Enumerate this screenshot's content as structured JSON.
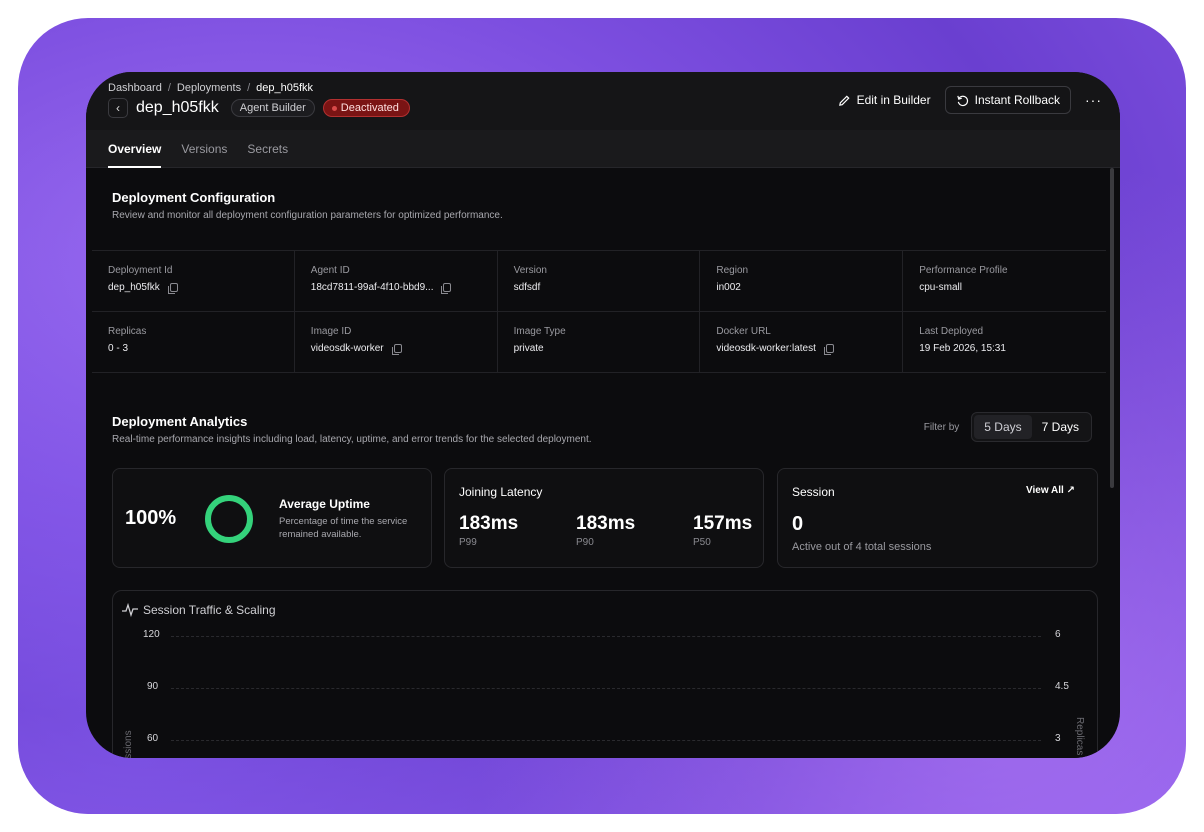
{
  "breadcrumb": [
    "Dashboard",
    "Deployments",
    "dep_h05fkk"
  ],
  "header": {
    "title": "dep_h05fkk",
    "tag_builder": "Agent Builder",
    "tag_status": "Deactivated",
    "edit_label": "Edit in Builder",
    "rollback_label": "Instant Rollback",
    "more_label": "···"
  },
  "tabs": [
    "Overview",
    "Versions",
    "Secrets"
  ],
  "config": {
    "title": "Deployment Configuration",
    "desc": "Review and monitor all deployment configuration parameters for optimized performance.",
    "row1": [
      {
        "label": "Deployment Id",
        "value": "dep_h05fkk",
        "copy": true
      },
      {
        "label": "Agent ID",
        "value": "18cd7811-99af-4f10-bbd9...",
        "copy": true
      },
      {
        "label": "Version",
        "value": "sdfsdf"
      },
      {
        "label": "Region",
        "value": "in002"
      },
      {
        "label": "Performance Profile",
        "value": "cpu-small"
      }
    ],
    "row2": [
      {
        "label": "Replicas",
        "value": "0 - 3"
      },
      {
        "label": "Image ID",
        "value": "videosdk-worker",
        "copy": true
      },
      {
        "label": "Image Type",
        "value": "private"
      },
      {
        "label": "Docker URL",
        "value": "videosdk-worker:latest",
        "copy": true
      },
      {
        "label": "Last Deployed",
        "value": "19 Feb 2026, 15:31"
      }
    ]
  },
  "analytics": {
    "title": "Deployment Analytics",
    "desc": "Real-time performance insights including load, latency, uptime, and error trends for the selected deployment.",
    "filter_label": "Filter by",
    "filter_options": [
      "5 Days",
      "7 Days"
    ],
    "uptime": {
      "value": "100%",
      "title": "Average Uptime",
      "desc": "Percentage of time the service remained available.",
      "ring_fraction": 1.0,
      "color": "#34d27b"
    },
    "latency": {
      "title": "Joining Latency",
      "items": [
        {
          "value": "183ms",
          "label": "P99"
        },
        {
          "value": "183ms",
          "label": "P90"
        },
        {
          "value": "157ms",
          "label": "P50"
        }
      ]
    },
    "session": {
      "title": "Session",
      "view_all": "View All",
      "value": "0",
      "desc": "Active out of 4 total sessions"
    }
  },
  "chart_data": {
    "type": "line",
    "title": "Session Traffic & Scaling",
    "ylabel": "Sessions",
    "y2label": "Replicas",
    "y_ticks": [
      "120",
      "90",
      "60"
    ],
    "y2_ticks": [
      "6",
      "4.5",
      "3"
    ],
    "ylim": [
      0,
      120
    ],
    "y2lim": [
      0,
      6
    ],
    "series": []
  }
}
